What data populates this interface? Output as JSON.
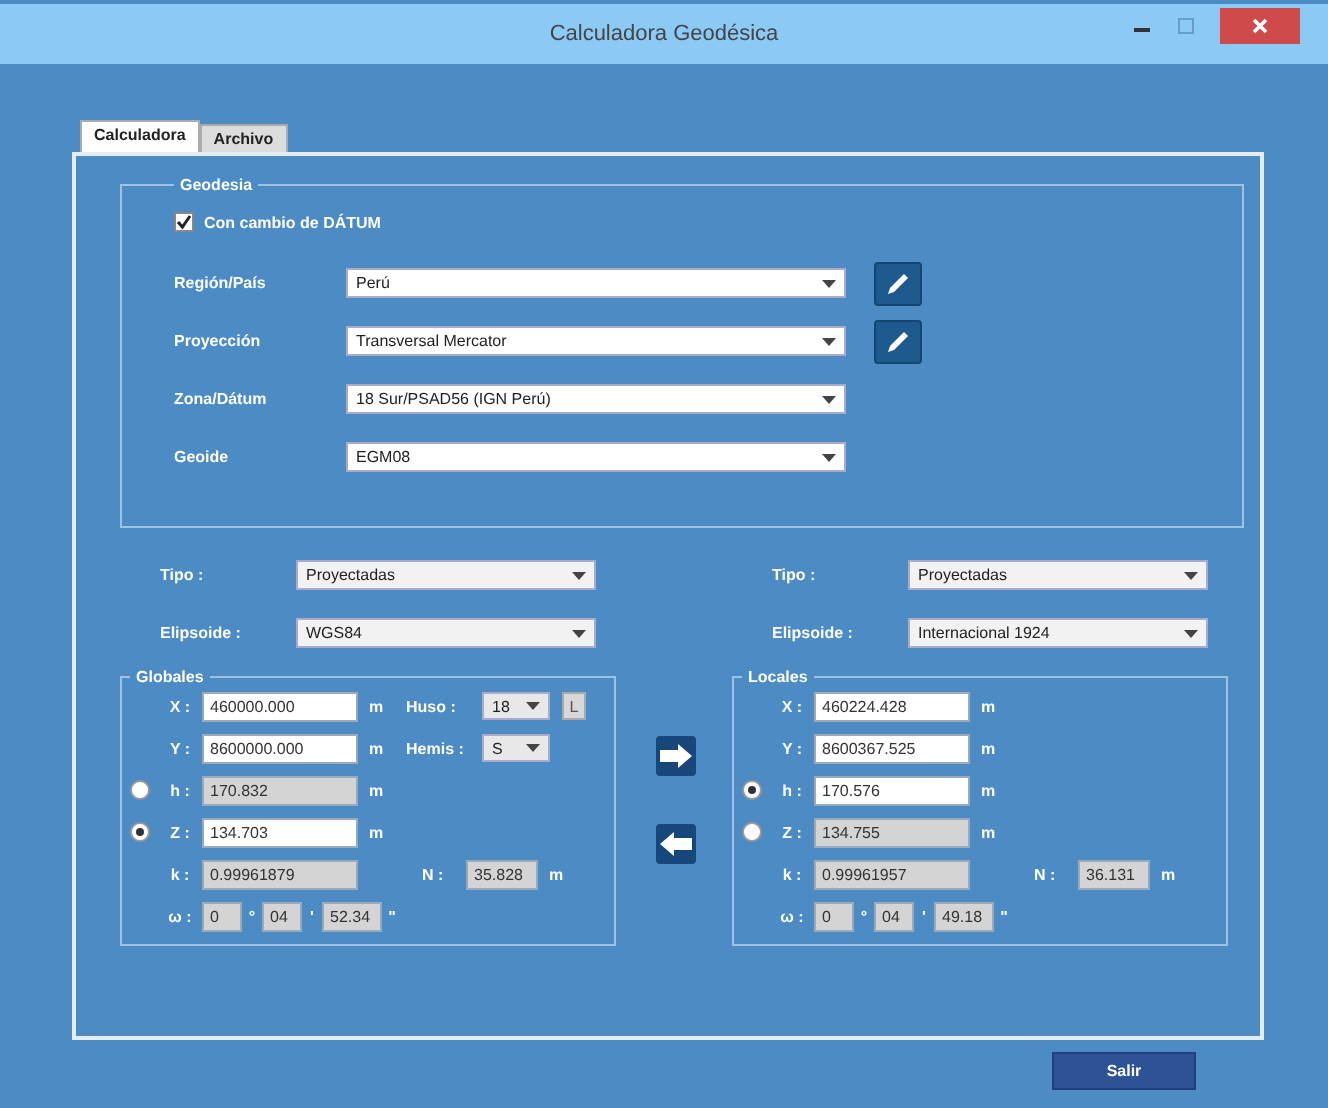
{
  "window": {
    "title": "Calculadora Geodésica"
  },
  "tabs": [
    {
      "label": "Calculadora",
      "selected": true
    },
    {
      "label": "Archivo",
      "selected": false
    }
  ],
  "geodesia": {
    "title": "Geodesia",
    "datum_change": {
      "label": "Con cambio de DÁTUM",
      "checked": true
    },
    "fields": [
      {
        "label": "Región/País",
        "value": "Perú",
        "editable": true
      },
      {
        "label": "Proyección",
        "value": "Transversal Mercator",
        "editable": true
      },
      {
        "label": "Zona/Dátum",
        "value": "18 Sur/PSAD56 (IGN Perú)",
        "editable": false
      },
      {
        "label": "Geoide",
        "value": "EGM08",
        "editable": false
      }
    ]
  },
  "sides": [
    {
      "type": {
        "label": "Tipo :",
        "value": "Proyectadas"
      },
      "ellipsoid": {
        "label": "Elipsoide :",
        "value": "WGS84"
      },
      "title": "Globales",
      "coords": [
        {
          "kind": "plain",
          "label": "X :",
          "value": "460000.000",
          "unit": "m",
          "disabled": false
        },
        {
          "kind": "plain",
          "label": "Y :",
          "value": "8600000.000",
          "unit": "m",
          "disabled": false
        },
        {
          "kind": "radio",
          "label": "h :",
          "value": "170.832",
          "unit": "m",
          "disabled": true,
          "selected": false
        },
        {
          "kind": "radio",
          "label": "Z :",
          "value": "134.703",
          "unit": "m",
          "disabled": false,
          "selected": true
        }
      ],
      "k": {
        "label": "k :",
        "value": "0.99961879"
      },
      "w": {
        "label": "ω :",
        "parts": [
          {
            "value": "0",
            "mark": "°"
          },
          {
            "value": "04",
            "mark": "'"
          },
          {
            "value": "52.34",
            "mark": "\""
          }
        ]
      },
      "n": {
        "label": "N :",
        "value": "35.828",
        "unit": "m"
      },
      "zone": {
        "huso_label": "Huso :",
        "huso": "18",
        "letter": "L",
        "hemis_label": "Hemis :",
        "hemis": "S"
      }
    },
    {
      "type": {
        "label": "Tipo :",
        "value": "Proyectadas"
      },
      "ellipsoid": {
        "label": "Elipsoide :",
        "value": "Internacional 1924"
      },
      "title": "Locales",
      "coords": [
        {
          "kind": "plain",
          "label": "X :",
          "value": "460224.428",
          "unit": "m",
          "disabled": false
        },
        {
          "kind": "plain",
          "label": "Y :",
          "value": "8600367.525",
          "unit": "m",
          "disabled": false
        },
        {
          "kind": "radio",
          "label": "h :",
          "value": "170.576",
          "unit": "m",
          "disabled": false,
          "selected": true
        },
        {
          "kind": "radio",
          "label": "Z :",
          "value": "134.755",
          "unit": "m",
          "disabled": true,
          "selected": false
        }
      ],
      "k": {
        "label": "k :",
        "value": "0.99961957"
      },
      "w": {
        "label": "ω :",
        "parts": [
          {
            "value": "0",
            "mark": "°"
          },
          {
            "value": "04",
            "mark": "'"
          },
          {
            "value": "49.18",
            "mark": "\""
          }
        ]
      },
      "n": {
        "label": "N :",
        "value": "36.131",
        "unit": "m"
      }
    }
  ],
  "exit_button": "Salir"
}
